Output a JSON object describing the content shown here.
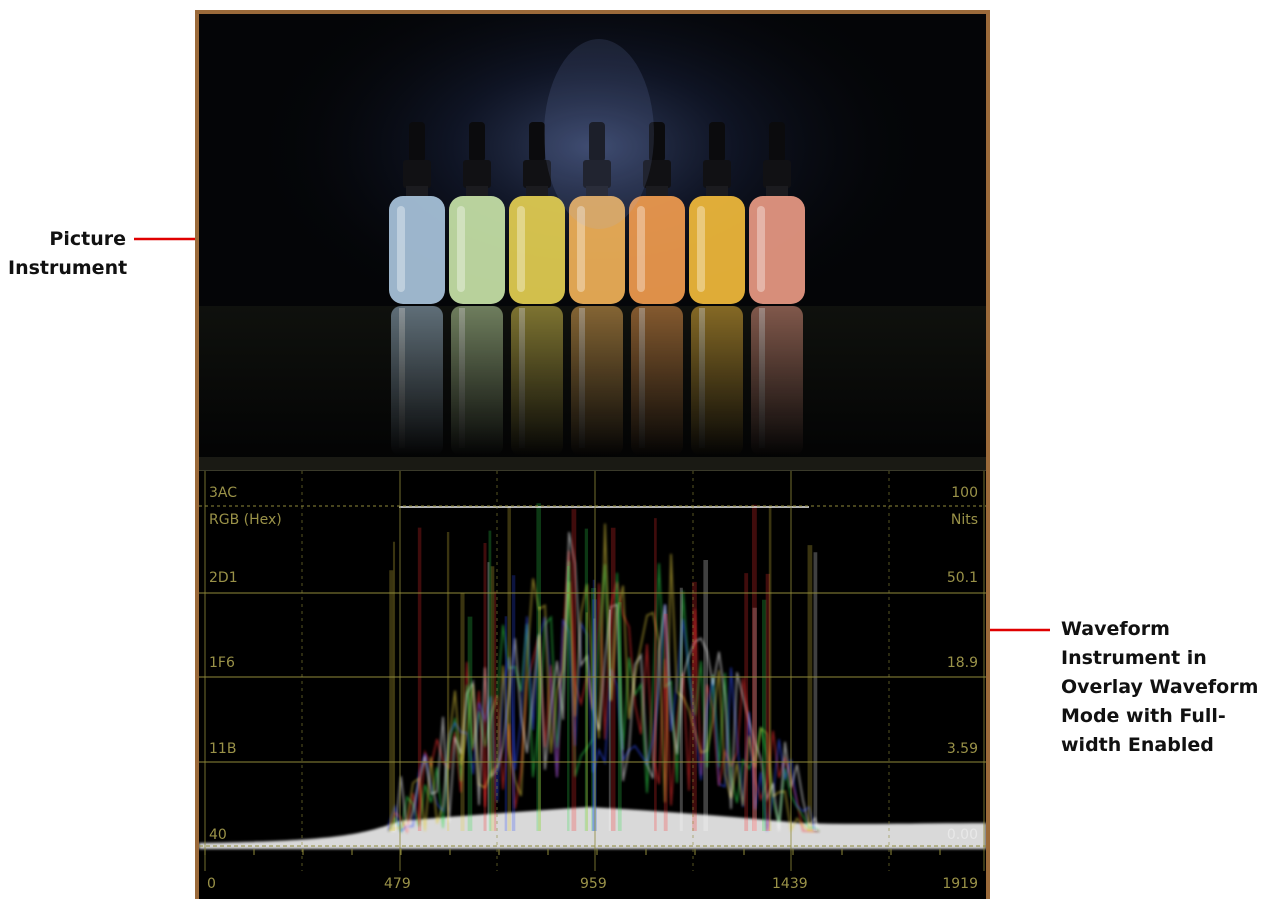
{
  "callouts": {
    "picture": {
      "lines": [
        "Picture",
        "Instrument"
      ]
    },
    "waveform": {
      "lines": [
        "Waveform",
        "Instrument in",
        "Overlay Waveform",
        "Mode with Full-",
        "width Enabled"
      ]
    }
  },
  "waveform": {
    "left_labels": [
      {
        "text": "3AC"
      },
      {
        "text": "RGB (Hex)"
      },
      {
        "text": "2D1"
      },
      {
        "text": "1F6"
      },
      {
        "text": "11B"
      },
      {
        "text": "40"
      }
    ],
    "right_labels": [
      {
        "text": "100"
      },
      {
        "text": "Nits"
      },
      {
        "text": "50.1"
      },
      {
        "text": "18.9"
      },
      {
        "text": "3.59"
      },
      {
        "text": "0.00"
      }
    ],
    "x_labels": [
      "0",
      "479",
      "959",
      "1439",
      "1919"
    ]
  },
  "picture": {
    "bottles": [
      {
        "color": "#a9c4dc"
      },
      {
        "color": "#c8e3a8"
      },
      {
        "color": "#e4cf52"
      },
      {
        "color": "#f1b259"
      },
      {
        "color": "#f19c4f"
      },
      {
        "color": "#f2bb3c"
      },
      {
        "color": "#e99a84"
      }
    ]
  },
  "colors": {
    "frame": "#9b6a3a",
    "graticule": "#8f8a3a",
    "arrow": "#e00000"
  }
}
